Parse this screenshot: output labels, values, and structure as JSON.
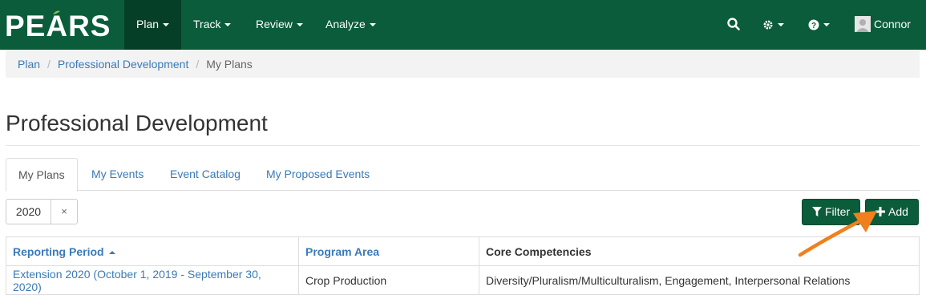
{
  "navbar": {
    "logo_text": "PEARS",
    "menu": [
      {
        "label": "Plan"
      },
      {
        "label": "Track"
      },
      {
        "label": "Review"
      },
      {
        "label": "Analyze"
      }
    ],
    "user": {
      "name": "Connor"
    },
    "icons": {
      "search": "search-icon",
      "settings": "gear-icon",
      "help": "question-circle-icon",
      "avatar": "user-avatar-icon"
    },
    "brand_color": "#0a5c3a"
  },
  "breadcrumb": {
    "items": [
      {
        "label": "Plan"
      },
      {
        "label": "Professional Development"
      },
      {
        "label": "My Plans"
      }
    ],
    "separator": "/"
  },
  "page": {
    "title": "Professional Development"
  },
  "tabs": [
    {
      "label": "My Plans",
      "active": true
    },
    {
      "label": "My Events"
    },
    {
      "label": "Event Catalog"
    },
    {
      "label": "My Proposed Events"
    }
  ],
  "filter_chip": {
    "value": "2020",
    "remove": "×"
  },
  "actions": {
    "filter_label": "Filter",
    "add_label": "Add"
  },
  "table": {
    "headers": [
      "Reporting Period",
      "Program Area",
      "Core Competencies"
    ],
    "rows": [
      {
        "reporting_period": "Extension 2020 (October 1, 2019 - September 30, 2020)",
        "program_area": "Crop Production",
        "core_competencies": "Diversity/Pluralism/Multiculturalism, Engagement, Interpersonal Relations"
      }
    ]
  },
  "annotation": {
    "arrow_color": "#f0801e"
  }
}
